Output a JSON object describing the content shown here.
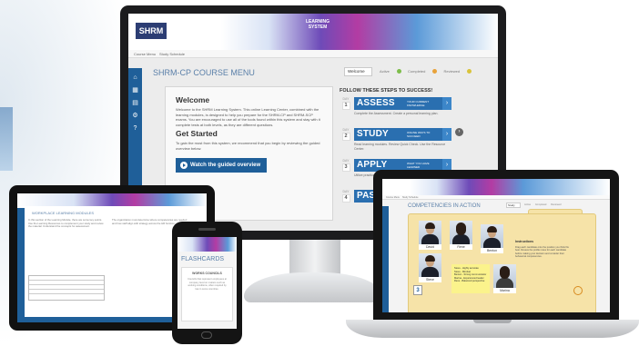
{
  "colors": {
    "primary_blue": "#1f5f99",
    "step_blue": "#2a6fb0",
    "heading_blue": "#5a7fa8",
    "folder_yellow": "#f6e3a8"
  },
  "desktop": {
    "brand_logo": "SHRM",
    "brand_title": "LEARNING SYSTEM",
    "nav": [
      "Course Menu",
      "Study Schedule"
    ],
    "menu_title": "SHRM-CP COURSE MENU",
    "view_select": "Welcome",
    "status_legend": [
      "Active",
      "Completed",
      "Reviewed"
    ],
    "welcome": {
      "heading": "Welcome",
      "text": "Welcome to the SHRM Learning System. This online Learning Center, combined with the learning modules, is designed to help you prepare for the SHRM-CP and SHRM-SCP exams. You are encouraged to use all of the tools found within this system and stay with it complete tests at both levels, as they are different questions."
    },
    "get_started": {
      "heading": "Get Started",
      "text": "To gain the most from this system, we recommend that you begin by reviewing the guided overview below."
    },
    "guided_button": "Watch the guided overview",
    "steps_title": "FOLLOW THESE STEPS TO SUCCESS!",
    "steps": [
      {
        "day": "1",
        "name": "ASSESS",
        "sub": "YOUR CURRENT KNOWLEDGE",
        "desc": "Complete the Assessment. Create a personal learning plan."
      },
      {
        "day": "2",
        "name": "STUDY",
        "sub": "ONLINE WAYS TO SUCCEED",
        "desc": "Read learning modules. Review Quick Check. Use the Resource Center."
      },
      {
        "day": "3",
        "name": "APPLY",
        "sub": "WHAT YOU HAVE LEARNED",
        "desc": "Utilize practice scenarios. Engage in Competencies in Action."
      },
      {
        "day": "4",
        "name": "PASS",
        "sub": "",
        "desc": ""
      }
    ]
  },
  "tablet": {
    "title": "WORKPLACE LEARNING MODULES",
    "col_left": "In this section of the Learning Module, there are some key points. Use the Learning Resources to complement your study and review the material. Understand the concepts for assessment.",
    "col_right": "The organization must determine where competencies are needed and how staff align with strategy across the HR function."
  },
  "phone": {
    "title": "FLASHCARDS",
    "card_title": "WORKS COUNCILS",
    "card_text": "Councils that represent employees at company level on matters such as working conditions, often required by law in some countries."
  },
  "laptop": {
    "nav": [
      "Course Menu",
      "Study Schedule"
    ],
    "title": "COMPETENCIES IN ACTION",
    "view_select": "Study",
    "legend": [
      "Active",
      "Completed",
      "Reviewed"
    ],
    "people": [
      "David",
      "Rene",
      "Benton",
      "Steve",
      "Marina"
    ],
    "sticky_lines": [
      "Steve - Highly accurate",
      "Steve - Mindset",
      "Benton - Strong communicator",
      "Marina - Experienced leader",
      "Rene - Balanced perspective"
    ],
    "notes_title": "Instructions",
    "notes_text": "Drag each candidate onto the position you think fits best. Review the profile notes for each candidate before making your decision and consider their behavioral competencies.",
    "badge_num": "3"
  }
}
